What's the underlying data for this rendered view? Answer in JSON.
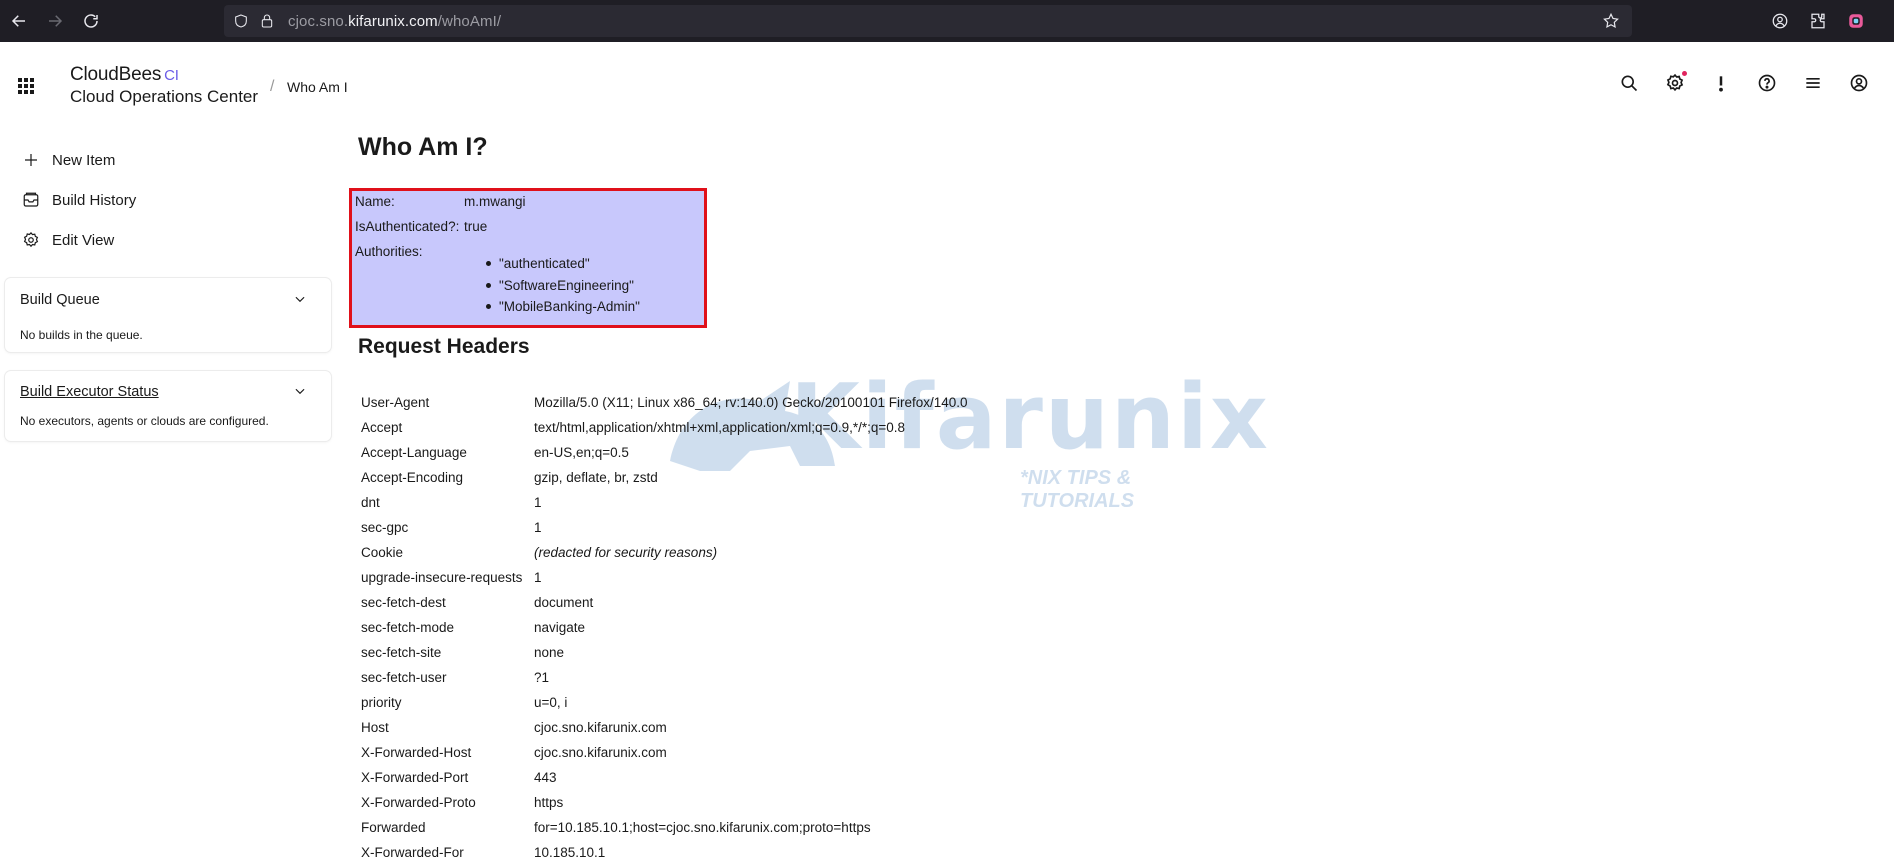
{
  "browser": {
    "url_prefix": "cjoc.sno.",
    "url_domain": "kifarunix.com",
    "url_path": "/whoAmI/"
  },
  "header": {
    "brand": "CloudBees",
    "brand_tag": "CI",
    "brand_sub": "Cloud Operations Center",
    "breadcrumb_sep": "/",
    "breadcrumb": "Who Am I"
  },
  "sidebar": {
    "tasks": [
      {
        "label": "New Item",
        "icon": "plus-icon"
      },
      {
        "label": "Build History",
        "icon": "history-icon"
      },
      {
        "label": "Edit View",
        "icon": "gear-icon"
      }
    ],
    "build_queue": {
      "title": "Build Queue",
      "body": "No builds in the queue."
    },
    "executors": {
      "title": "Build Executor Status",
      "body": "No executors, agents or clouds are configured."
    }
  },
  "main": {
    "title": "Who Am I?",
    "whoami": {
      "name_label": "Name:",
      "name_value": "m.mwangi",
      "auth_label": "IsAuthenticated?:",
      "auth_value": "true",
      "authorities_label": "Authorities:",
      "authorities": [
        "\"authenticated\"",
        "\"SoftwareEngineering\"",
        "\"MobileBanking-Admin\""
      ]
    },
    "headers_title": "Request Headers",
    "headers": [
      {
        "key": "User-Agent",
        "value": "Mozilla/5.0 (X11; Linux x86_64; rv:140.0) Gecko/20100101 Firefox/140.0"
      },
      {
        "key": "Accept",
        "value": "text/html,application/xhtml+xml,application/xml;q=0.9,*/*;q=0.8"
      },
      {
        "key": "Accept-Language",
        "value": "en-US,en;q=0.5"
      },
      {
        "key": "Accept-Encoding",
        "value": "gzip, deflate, br, zstd"
      },
      {
        "key": "dnt",
        "value": "1"
      },
      {
        "key": "sec-gpc",
        "value": "1"
      },
      {
        "key": "Cookie",
        "value": "(redacted for security reasons)"
      },
      {
        "key": "upgrade-insecure-requests",
        "value": "1"
      },
      {
        "key": "sec-fetch-dest",
        "value": "document"
      },
      {
        "key": "sec-fetch-mode",
        "value": "navigate"
      },
      {
        "key": "sec-fetch-site",
        "value": "none"
      },
      {
        "key": "sec-fetch-user",
        "value": "?1"
      },
      {
        "key": "priority",
        "value": "u=0, i"
      },
      {
        "key": "Host",
        "value": "cjoc.sno.kifarunix.com"
      },
      {
        "key": "X-Forwarded-Host",
        "value": "cjoc.sno.kifarunix.com"
      },
      {
        "key": "X-Forwarded-Port",
        "value": "443"
      },
      {
        "key": "X-Forwarded-Proto",
        "value": "https"
      },
      {
        "key": "Forwarded",
        "value": "for=10.185.10.1;host=cjoc.sno.kifarunix.com;proto=https"
      },
      {
        "key": "X-Forwarded-For",
        "value": "10.185.10.1"
      }
    ]
  },
  "watermark": {
    "text": "Kifarunix",
    "sub": "*NIX TIPS & TUTORIALS"
  }
}
